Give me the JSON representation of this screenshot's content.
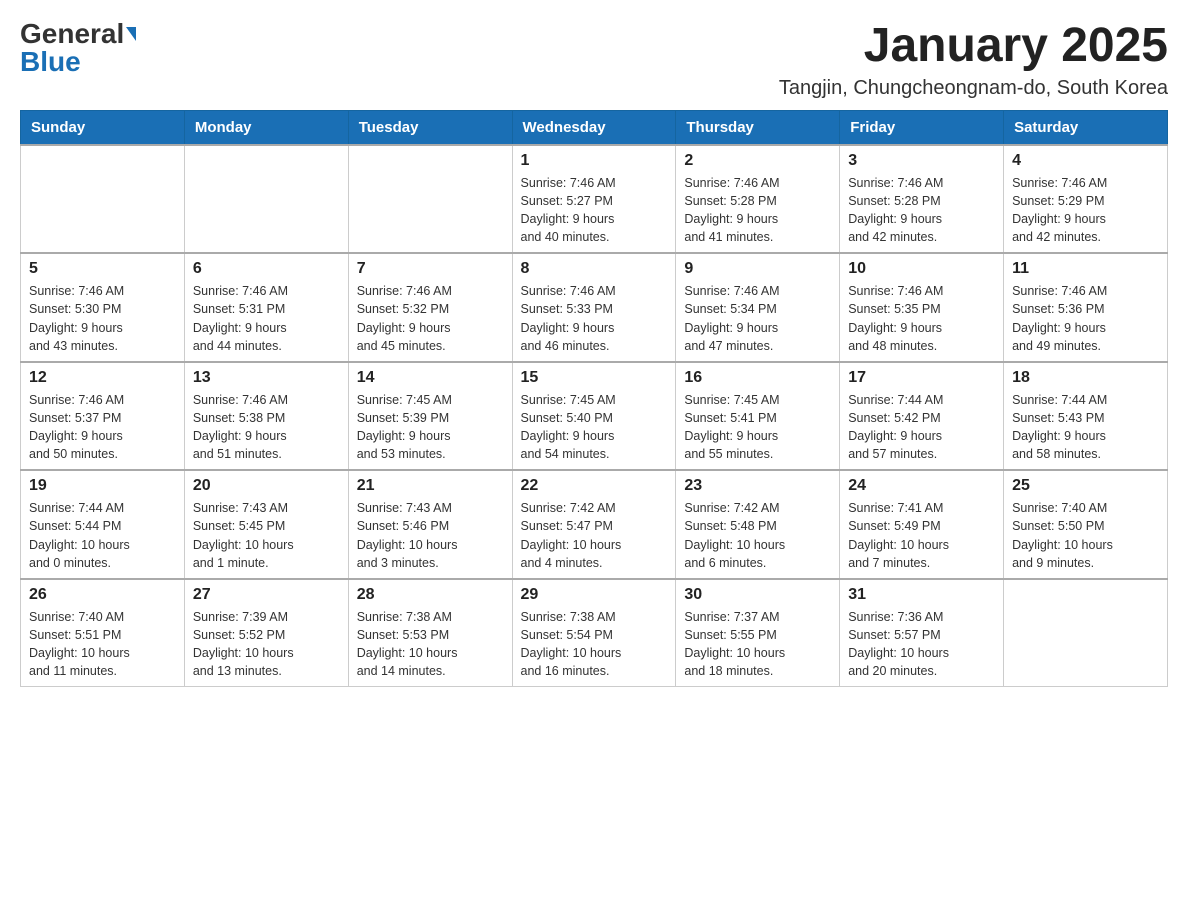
{
  "header": {
    "logo_general": "General",
    "logo_blue": "Blue",
    "title": "January 2025",
    "subtitle": "Tangjin, Chungcheongnam-do, South Korea"
  },
  "days_of_week": [
    "Sunday",
    "Monday",
    "Tuesday",
    "Wednesday",
    "Thursday",
    "Friday",
    "Saturday"
  ],
  "weeks": [
    [
      {
        "day": "",
        "info": ""
      },
      {
        "day": "",
        "info": ""
      },
      {
        "day": "",
        "info": ""
      },
      {
        "day": "1",
        "info": "Sunrise: 7:46 AM\nSunset: 5:27 PM\nDaylight: 9 hours\nand 40 minutes."
      },
      {
        "day": "2",
        "info": "Sunrise: 7:46 AM\nSunset: 5:28 PM\nDaylight: 9 hours\nand 41 minutes."
      },
      {
        "day": "3",
        "info": "Sunrise: 7:46 AM\nSunset: 5:28 PM\nDaylight: 9 hours\nand 42 minutes."
      },
      {
        "day": "4",
        "info": "Sunrise: 7:46 AM\nSunset: 5:29 PM\nDaylight: 9 hours\nand 42 minutes."
      }
    ],
    [
      {
        "day": "5",
        "info": "Sunrise: 7:46 AM\nSunset: 5:30 PM\nDaylight: 9 hours\nand 43 minutes."
      },
      {
        "day": "6",
        "info": "Sunrise: 7:46 AM\nSunset: 5:31 PM\nDaylight: 9 hours\nand 44 minutes."
      },
      {
        "day": "7",
        "info": "Sunrise: 7:46 AM\nSunset: 5:32 PM\nDaylight: 9 hours\nand 45 minutes."
      },
      {
        "day": "8",
        "info": "Sunrise: 7:46 AM\nSunset: 5:33 PM\nDaylight: 9 hours\nand 46 minutes."
      },
      {
        "day": "9",
        "info": "Sunrise: 7:46 AM\nSunset: 5:34 PM\nDaylight: 9 hours\nand 47 minutes."
      },
      {
        "day": "10",
        "info": "Sunrise: 7:46 AM\nSunset: 5:35 PM\nDaylight: 9 hours\nand 48 minutes."
      },
      {
        "day": "11",
        "info": "Sunrise: 7:46 AM\nSunset: 5:36 PM\nDaylight: 9 hours\nand 49 minutes."
      }
    ],
    [
      {
        "day": "12",
        "info": "Sunrise: 7:46 AM\nSunset: 5:37 PM\nDaylight: 9 hours\nand 50 minutes."
      },
      {
        "day": "13",
        "info": "Sunrise: 7:46 AM\nSunset: 5:38 PM\nDaylight: 9 hours\nand 51 minutes."
      },
      {
        "day": "14",
        "info": "Sunrise: 7:45 AM\nSunset: 5:39 PM\nDaylight: 9 hours\nand 53 minutes."
      },
      {
        "day": "15",
        "info": "Sunrise: 7:45 AM\nSunset: 5:40 PM\nDaylight: 9 hours\nand 54 minutes."
      },
      {
        "day": "16",
        "info": "Sunrise: 7:45 AM\nSunset: 5:41 PM\nDaylight: 9 hours\nand 55 minutes."
      },
      {
        "day": "17",
        "info": "Sunrise: 7:44 AM\nSunset: 5:42 PM\nDaylight: 9 hours\nand 57 minutes."
      },
      {
        "day": "18",
        "info": "Sunrise: 7:44 AM\nSunset: 5:43 PM\nDaylight: 9 hours\nand 58 minutes."
      }
    ],
    [
      {
        "day": "19",
        "info": "Sunrise: 7:44 AM\nSunset: 5:44 PM\nDaylight: 10 hours\nand 0 minutes."
      },
      {
        "day": "20",
        "info": "Sunrise: 7:43 AM\nSunset: 5:45 PM\nDaylight: 10 hours\nand 1 minute."
      },
      {
        "day": "21",
        "info": "Sunrise: 7:43 AM\nSunset: 5:46 PM\nDaylight: 10 hours\nand 3 minutes."
      },
      {
        "day": "22",
        "info": "Sunrise: 7:42 AM\nSunset: 5:47 PM\nDaylight: 10 hours\nand 4 minutes."
      },
      {
        "day": "23",
        "info": "Sunrise: 7:42 AM\nSunset: 5:48 PM\nDaylight: 10 hours\nand 6 minutes."
      },
      {
        "day": "24",
        "info": "Sunrise: 7:41 AM\nSunset: 5:49 PM\nDaylight: 10 hours\nand 7 minutes."
      },
      {
        "day": "25",
        "info": "Sunrise: 7:40 AM\nSunset: 5:50 PM\nDaylight: 10 hours\nand 9 minutes."
      }
    ],
    [
      {
        "day": "26",
        "info": "Sunrise: 7:40 AM\nSunset: 5:51 PM\nDaylight: 10 hours\nand 11 minutes."
      },
      {
        "day": "27",
        "info": "Sunrise: 7:39 AM\nSunset: 5:52 PM\nDaylight: 10 hours\nand 13 minutes."
      },
      {
        "day": "28",
        "info": "Sunrise: 7:38 AM\nSunset: 5:53 PM\nDaylight: 10 hours\nand 14 minutes."
      },
      {
        "day": "29",
        "info": "Sunrise: 7:38 AM\nSunset: 5:54 PM\nDaylight: 10 hours\nand 16 minutes."
      },
      {
        "day": "30",
        "info": "Sunrise: 7:37 AM\nSunset: 5:55 PM\nDaylight: 10 hours\nand 18 minutes."
      },
      {
        "day": "31",
        "info": "Sunrise: 7:36 AM\nSunset: 5:57 PM\nDaylight: 10 hours\nand 20 minutes."
      },
      {
        "day": "",
        "info": ""
      }
    ]
  ]
}
